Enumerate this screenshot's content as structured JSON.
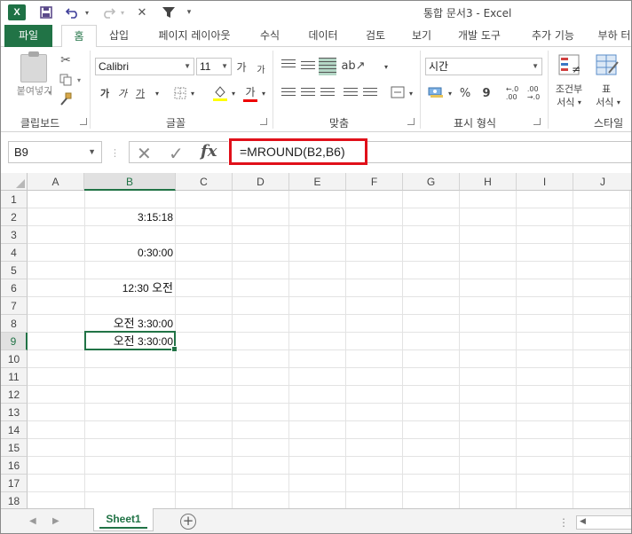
{
  "app": {
    "logo_text": "X",
    "title": "통합 문서3 - Excel"
  },
  "tabs": {
    "file": "파일",
    "home": "홈",
    "insert": "삽입",
    "page_layout": "페이지 레이아웃",
    "formulas": "수식",
    "data": "데이터",
    "review": "검토",
    "view": "보기",
    "developer": "개발 도구",
    "addins": "추가 기능",
    "more": "부하 터"
  },
  "ribbon": {
    "clipboard": {
      "label": "클립보드",
      "paste": "붙여넣기"
    },
    "font": {
      "label": "글꼴",
      "name": "Calibri",
      "size": "11",
      "grow": "가",
      "shrink": "가",
      "bold": "가",
      "italic": "가",
      "underline": "가",
      "color_letter": "가"
    },
    "alignment": {
      "label": "맞춤"
    },
    "number": {
      "label": "표시 형식",
      "format": "시간",
      "percent": "%",
      "comma": "9"
    },
    "styles": {
      "label": "스타일",
      "conditional": "조건부",
      "conditional_sub": "서식",
      "table": "표",
      "table_sub": "서식"
    }
  },
  "formula_bar": {
    "name_box": "B9",
    "cancel": "✕",
    "enter": "✓",
    "fx": "fx",
    "formula": "=MROUND(B2,B6)"
  },
  "grid": {
    "columns": [
      "A",
      "B",
      "C",
      "D",
      "E",
      "F",
      "G",
      "H",
      "I",
      "J"
    ],
    "rows": [
      "1",
      "2",
      "3",
      "4",
      "5",
      "6",
      "7",
      "8",
      "9",
      "10",
      "11",
      "12",
      "13",
      "14",
      "15",
      "16",
      "17",
      "18"
    ],
    "selected_column": "B",
    "selected_row": "9",
    "cells": {
      "B2": "3:15:18",
      "B4": "0:30:00",
      "B6_time": "12:30",
      "B6_ampm": "오전",
      "B8_ampm": "오전",
      "B8_time": "3:30:00",
      "B9_ampm": "오전",
      "B9_time": "3:30:00"
    }
  },
  "sheets": {
    "active": "Sheet1",
    "add": "+"
  },
  "colors": {
    "accent": "#217346",
    "highlight_box": "#e0101a"
  }
}
